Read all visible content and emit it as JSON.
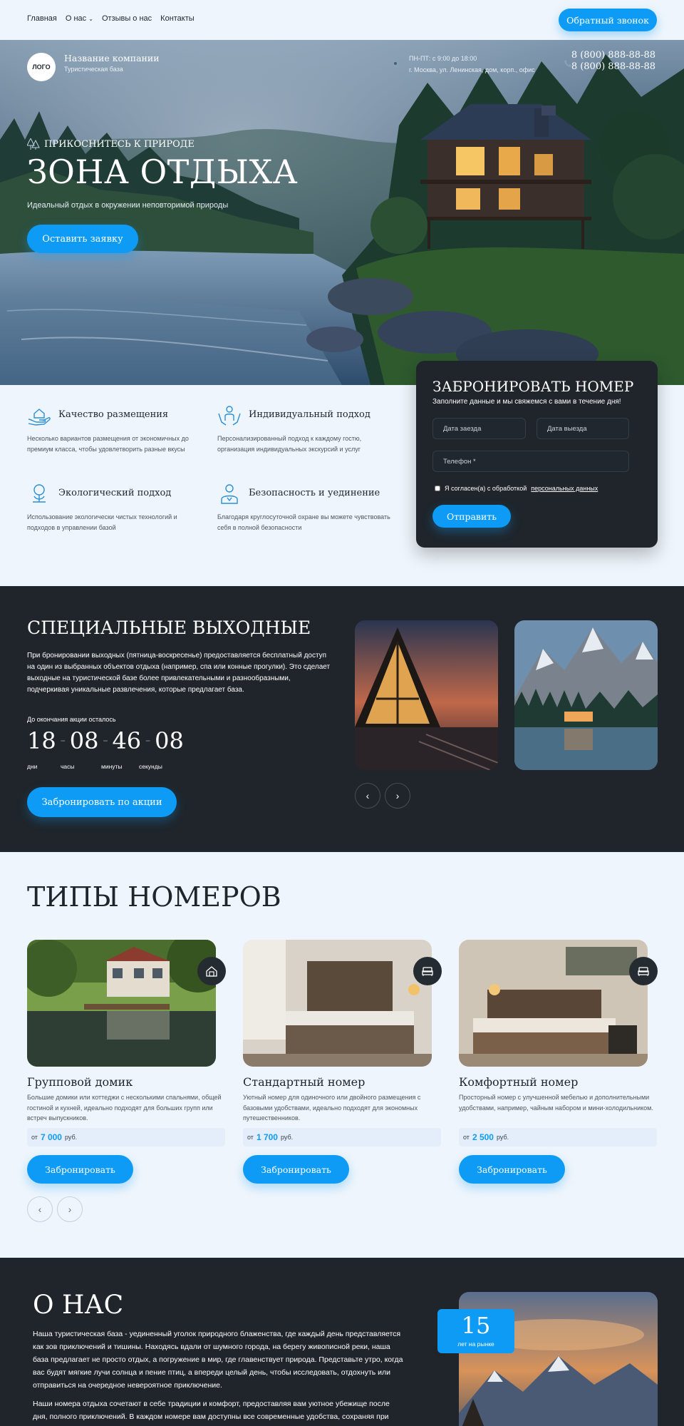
{
  "nav": {
    "items": [
      "Главная",
      "О нас",
      "Отзывы о нас",
      "Контакты"
    ],
    "callback_label": "Обратный звонок"
  },
  "hero": {
    "logo": "ЛОГО",
    "company_name": "Название компании",
    "company_sub": "Туристическая база",
    "hours_line1": "ПН-ПТ: с 9:00 до  18:00",
    "hours_line2": "г. Москва, ул. Ленинская, дом, корп., офис",
    "phone1": "8 (800) 888-88-88",
    "phone2": "8 (800) 888-88-88",
    "kicker": "ПРИКОСНИТЕСЬ К ПРИРОДЕ",
    "title": "ЗОНА ОТДЫХА",
    "subtitle": "Идеальный отдых в окружении неповторимой природы",
    "cta_label": "Оставить заявку"
  },
  "features": [
    {
      "title": "Качество размещения",
      "desc": "Несколько вариантов размещения от экономичных до премиум класса, чтобы удовлетворить разные вкусы"
    },
    {
      "title": "Индивидуальный подход",
      "desc": "Персонализированный подход к каждому гостю, организация индивидуальных экскурсий и услуг"
    },
    {
      "title": "Экологический подход",
      "desc": "Использование экологически чистых технологий и подходов в управлении базой"
    },
    {
      "title": "Безопасность и уединение",
      "desc": "Благодаря круглосуточной охране вы можете чувствовать себя в полной безопасности"
    }
  ],
  "booking": {
    "title": "ЗАБРОНИРОВАТЬ НОМЕР",
    "subtitle": "Заполните данные и мы свяжемся с вами в течение дня!",
    "checkin_placeholder": "Дата заезда",
    "checkout_placeholder": "Дата выезда",
    "phone_placeholder": "Телефон *",
    "agree_text": "Я согласен(а) с обработкой",
    "agree_link": "персональных данных",
    "submit_label": "Отправить"
  },
  "special": {
    "title": "СПЕЦИАЛЬНЫЕ ВЫХОДНЫЕ",
    "text": "При бронировании выходных (пятница-воскресенье) предоставляется бесплатный доступ на один из выбранных объектов отдыха (например, спа или конные прогулки).  Это сделает выходные на туристической базе более привлекательными и разнообразными, подчеркивая уникальные развлечения, которые предлагает база.",
    "timer_label": "До окончания акции осталось",
    "timer": {
      "days": "18",
      "hours": "08",
      "minutes": "46",
      "seconds": "08"
    },
    "units": {
      "days": "дни",
      "hours": "часы",
      "minutes": "минуты",
      "seconds": "секунды"
    },
    "cta_label": "Забронировать по акции",
    "prev": "‹",
    "next": "›"
  },
  "rooms": {
    "title": "ТИПЫ НОМЕРОВ",
    "items": [
      {
        "name": "Групповой домик",
        "desc": "Большие домики или коттеджи с несколькими спальнями, общей гостиной и кухней, идеально подходят для больших групп или встреч выпускников.",
        "price_prefix": "от",
        "price": "7 000",
        "price_suffix": "руб.",
        "button": "Забронировать"
      },
      {
        "name": "Стандартный номер",
        "desc": "Уютный номер для одиночного или двойного размещения с базовыми удобствами, идеально подходят для экономных путешественников.",
        "price_prefix": "от",
        "price": "1 700",
        "price_suffix": "руб.",
        "button": "Забронировать"
      },
      {
        "name": "Комфортный номер",
        "desc": "Просторный номер с улучшенной мебелью и дополнительными удобствами, например, чайным набором и мини-холодильником.",
        "price_prefix": "от",
        "price": "2 500",
        "price_suffix": "руб.",
        "button": "Забронировать"
      }
    ],
    "prev": "‹",
    "next": "›"
  },
  "about": {
    "title": "О НАС",
    "p1": "Наша туристическая база - уединенный уголок природного блаженства, где каждый день представляется как зов приключений и тишины. Находясь вдали от шумного города, на берегу живописной реки, наша база предлагает не просто отдых, а погружение в мир, где главенствует природа. Представьте утро, когда вас будят мягкие лучи солнца и пение птиц, а впереди целый день, чтобы исследовать, отдохнуть или отправиться на очередное невероятное приключение.",
    "p2": "Наши номера отдыха сочетают в себе традиции и комфорт, предоставляя вам уютное убежище после дня, полного приключений. В каждом номере вам доступны все современные удобства, сохраняя при этом близость к природе, друг от друга они отделены достаточным пространством",
    "years": "15",
    "years_label": "лет на рынке"
  },
  "colors": {
    "accent": "#0e9bf5",
    "dark": "#1f252b",
    "light_bg": "#eef5fc"
  }
}
